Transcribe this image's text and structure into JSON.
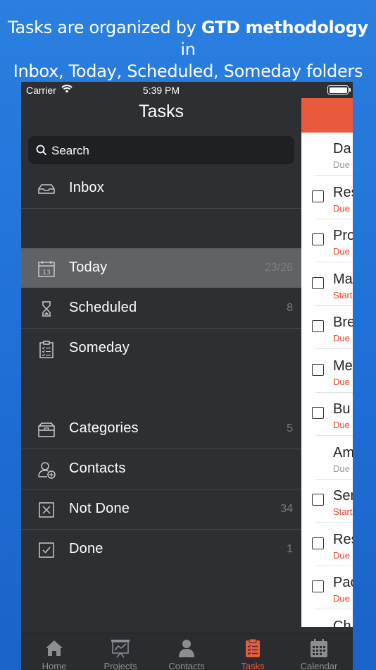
{
  "caption": {
    "line1_pre": "Tasks are organized by ",
    "line1_bold": "GTD methodology",
    "line1_post": " in",
    "line2": "Inbox, Today, Scheduled, Someday folders"
  },
  "status": {
    "carrier": "Carrier",
    "time": "5:39 PM"
  },
  "header": {
    "title": "Tasks"
  },
  "search": {
    "placeholder": "Search"
  },
  "menu": [
    {
      "label": "Inbox",
      "count": "",
      "icon": "inbox-icon"
    },
    {
      "label": "Today",
      "count": "23/26",
      "icon": "calendar-13-icon",
      "selected": true
    },
    {
      "label": "Scheduled",
      "count": "8",
      "icon": "hourglass-icon"
    },
    {
      "label": "Someday",
      "count": "",
      "icon": "clipboard-list-icon"
    },
    {
      "label": "Categories",
      "count": "5",
      "icon": "archive-box-icon"
    },
    {
      "label": "Contacts",
      "count": "",
      "icon": "add-contact-icon"
    },
    {
      "label": "Not Done",
      "count": "34",
      "icon": "x-box-icon"
    },
    {
      "label": "Done",
      "count": "1",
      "icon": "check-box-icon"
    }
  ],
  "tasks": [
    {
      "title": "Da",
      "sub": "Due",
      "sub_color": "#999999",
      "checkbox": false
    },
    {
      "title": "Res",
      "sub": "Due",
      "sub_color": "#e0432a",
      "checkbox": true
    },
    {
      "title": "Pro",
      "sub": "Due",
      "sub_color": "#e0432a",
      "checkbox": true
    },
    {
      "title": "Ma",
      "sub": "Start",
      "sub_color": "#e0432a",
      "checkbox": true
    },
    {
      "title": "Bre",
      "sub": "Due",
      "sub_color": "#e0432a",
      "checkbox": true
    },
    {
      "title": "Me",
      "sub": "Due",
      "sub_color": "#e0432a",
      "checkbox": true
    },
    {
      "title": "Bu",
      "sub": "Due",
      "sub_color": "#e0432a",
      "checkbox": true
    },
    {
      "title": "Am",
      "sub": "Due",
      "sub_color": "#999999",
      "checkbox": false
    },
    {
      "title": "Ser",
      "sub": "Start",
      "sub_color": "#e0432a",
      "checkbox": true
    },
    {
      "title": "Res",
      "sub": "Due",
      "sub_color": "#e0432a",
      "checkbox": true
    },
    {
      "title": "Pac",
      "sub": "Due",
      "sub_color": "#e0432a",
      "checkbox": true
    },
    {
      "title": "Ch",
      "sub": "",
      "sub_color": "#999999",
      "checkbox": false
    }
  ],
  "tabs": [
    {
      "label": "Home",
      "icon": "house-icon"
    },
    {
      "label": "Projects",
      "icon": "presentation-chart-icon"
    },
    {
      "label": "Contacts",
      "icon": "person-icon"
    },
    {
      "label": "Tasks",
      "icon": "clipboard-icon",
      "active": true
    },
    {
      "label": "Calendar",
      "icon": "calendar-grid-icon"
    }
  ],
  "colors": {
    "accent": "#ea5a3c",
    "sidebar_bg": "#2e2f33",
    "selected_bg": "#616266"
  }
}
